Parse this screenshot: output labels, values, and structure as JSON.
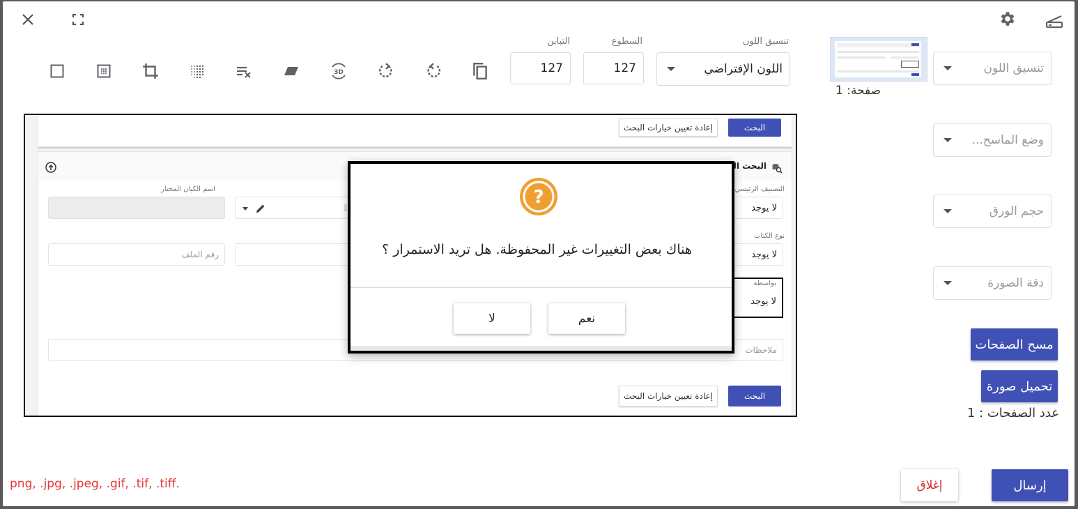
{
  "header": {
    "close_icon": "close-icon",
    "fullscreen_icon": "fullscreen-icon",
    "settings_icon": "gear-icon",
    "scanner_icon": "scanner-icon"
  },
  "toolbar": {
    "tools": [
      {
        "name": "crop-square-icon"
      },
      {
        "name": "grid-dots-icon"
      },
      {
        "name": "crop-icon"
      },
      {
        "name": "halftone-icon"
      },
      {
        "name": "clear-list-icon"
      },
      {
        "name": "skew-icon"
      },
      {
        "name": "rotate-3d-icon"
      },
      {
        "name": "rotate-right-icon"
      },
      {
        "name": "rotate-left-icon"
      },
      {
        "name": "copy-icon"
      }
    ],
    "contrast_label": "التباين",
    "contrast_value": "127",
    "brightness_label": "السطوع",
    "brightness_value": "127",
    "color_format_label": "تنسيق اللون",
    "color_format_value": "اللون الإفتراضي"
  },
  "sidebar": {
    "page_label": "صفحة: 1",
    "color_format_placeholder": "تنسيق اللون",
    "scanner_mode_placeholder": "وضع الماسح...",
    "paper_size_placeholder": "حجم الورق",
    "resolution_placeholder": "دقة الصورة",
    "scan_pages_label": "مسح الصفحات",
    "upload_image_label": "تحميل صورة",
    "page_count_label": "عدد الصفحات : 1"
  },
  "preview": {
    "search_button": "البحث",
    "reset_button": "إعادة تعيين خيارات البحث",
    "section_title": "البحث الم",
    "main_category_label": "التصنيف الرئيسي",
    "main_category_value": "لا يوجد",
    "book_type_label": "نوع الكتاب",
    "book_type_value": "لا يوجد",
    "by_label": "بواسطة",
    "by_value": "لا يوجد",
    "selected_entity_label": "اسم الكيان المختار",
    "file_number_placeholder": "رقم الملف",
    "notes_placeholder": "ملاحظات",
    "bottom_search_button": "البحث",
    "bottom_reset_button": "إعادة تعيين خيارات البحث"
  },
  "dialog": {
    "icon": "question-icon",
    "message": "هناك بعض التغييرات غير المحفوظة. هل تريد الاستمرار ؟",
    "yes_label": "نعم",
    "no_label": "لا"
  },
  "footer": {
    "formats_text": "png, .jpg, .jpeg, .gif, .tif, .tiff.",
    "close_label": "إغلاق",
    "send_label": "إرسال"
  },
  "colors": {
    "primary": "#3f51b5",
    "warning": "#f0a030",
    "error_text": "#e53935",
    "close_text": "#d32f2f"
  }
}
